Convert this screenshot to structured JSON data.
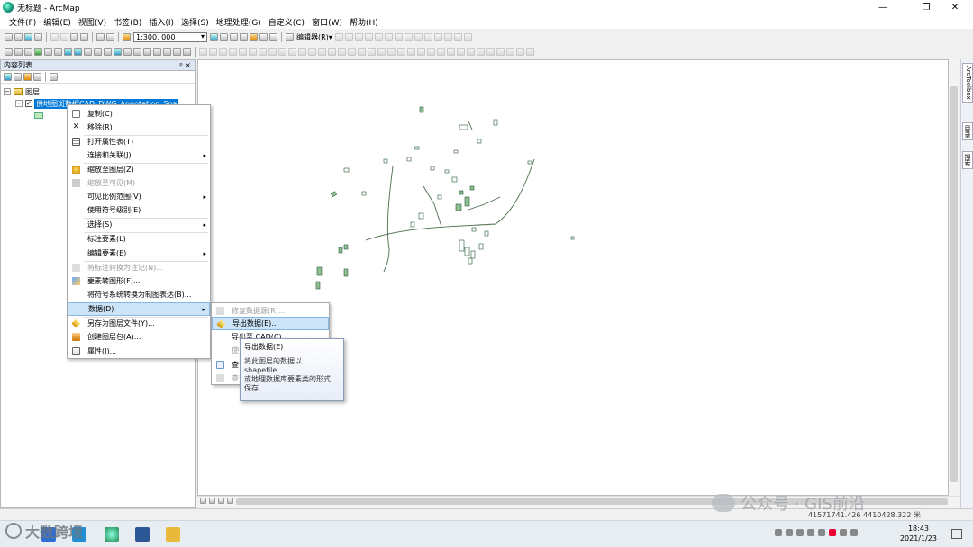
{
  "window": {
    "title": "无标题 - ArcMap"
  },
  "menubar": [
    "文件(F)",
    "编辑(E)",
    "视图(V)",
    "书签(B)",
    "插入(I)",
    "选择(S)",
    "地理处理(G)",
    "自定义(C)",
    "窗口(W)",
    "帮助(H)"
  ],
  "toolbar": {
    "scale_value": "1:300, 000",
    "editor_label": "编辑器(R)▾"
  },
  "toc": {
    "title": "内容列表",
    "pin_close": "ᵖ ×",
    "root_label": "图层",
    "layer_name": "供地图斑数据CAD_DWG_Annotation_Spa"
  },
  "context_menu": {
    "items": [
      {
        "label": "复制(C)",
        "disabled": false,
        "submenu": false,
        "icon": "copy-icon"
      },
      {
        "label": "移除(R)",
        "disabled": false,
        "submenu": false,
        "icon": "remove-icon"
      },
      {
        "label": "打开属性表(T)",
        "disabled": false,
        "submenu": false,
        "icon": "table-icon"
      },
      {
        "label": "连接和关联(J)",
        "disabled": false,
        "submenu": true,
        "icon": ""
      },
      {
        "label": "缩放至图层(Z)",
        "disabled": false,
        "submenu": false,
        "icon": "zoom-layer-icon"
      },
      {
        "label": "缩放至可见(M)",
        "disabled": true,
        "submenu": false,
        "icon": "zoom-visible-icon"
      },
      {
        "label": "可见比例范围(V)",
        "disabled": false,
        "submenu": true,
        "icon": ""
      },
      {
        "label": "使用符号级别(E)",
        "disabled": false,
        "submenu": false,
        "icon": ""
      },
      {
        "label": "选择(S)",
        "disabled": false,
        "submenu": true,
        "icon": ""
      },
      {
        "label": "标注要素(L)",
        "disabled": false,
        "submenu": false,
        "icon": ""
      },
      {
        "label": "编辑要素(E)",
        "disabled": false,
        "submenu": true,
        "icon": ""
      },
      {
        "label": "将标注转换为注记(N)...",
        "disabled": true,
        "submenu": false,
        "icon": "convert-label-icon"
      },
      {
        "label": "要素转图形(F)...",
        "disabled": false,
        "submenu": false,
        "icon": "feature-graphic-icon"
      },
      {
        "label": "将符号系统转换为制图表达(B)...",
        "disabled": false,
        "submenu": false,
        "icon": ""
      },
      {
        "label": "数据(D)",
        "disabled": false,
        "submenu": true,
        "icon": ""
      },
      {
        "label": "另存为图层文件(Y)...",
        "disabled": false,
        "submenu": false,
        "icon": "layer-file-icon"
      },
      {
        "label": "创建图层包(A)...",
        "disabled": false,
        "submenu": false,
        "icon": "layer-package-icon"
      },
      {
        "label": "属性(I)...",
        "disabled": false,
        "submenu": false,
        "icon": "properties-icon"
      }
    ]
  },
  "data_submenu": {
    "items": [
      {
        "label": "修复数据源(R)...",
        "disabled": true
      },
      {
        "label": "导出数据(E)...",
        "disabled": false
      },
      {
        "label": "导出至 CAD(C)...",
        "disabled": false
      },
      {
        "label": "使",
        "disabled": true
      },
      {
        "label": "查",
        "disabled": false
      },
      {
        "label": "查",
        "disabled": true
      }
    ]
  },
  "tooltip": {
    "title": "导出数据(E)",
    "lines": [
      "将此图层的数据以",
      "shapefile",
      "或地理数据库要素类的形式",
      "保存"
    ]
  },
  "right_tabs": [
    "ArcToolbox",
    "目录",
    "搜索"
  ],
  "status": {
    "coordinates": "41571741.426  4410428.322 米"
  },
  "taskbar": {
    "time": "18:43",
    "date": "2021/1/23"
  },
  "watermark": {
    "text": "公众号 · GIS前沿"
  },
  "corner_logo": {
    "text": "大数跨境"
  }
}
